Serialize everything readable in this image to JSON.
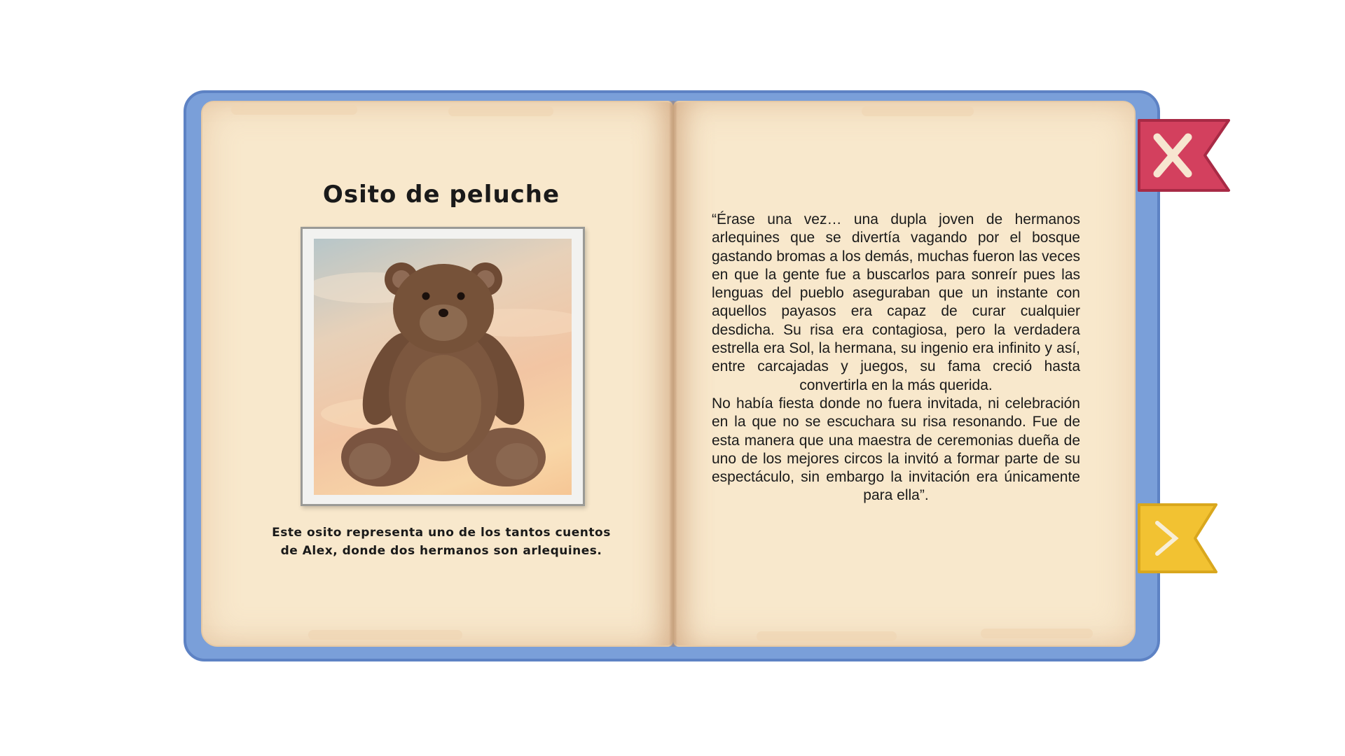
{
  "item": {
    "title": "Osito de peluche",
    "image_name": "teddy-bear",
    "caption": "Este osito representa uno de los tantos cuentos de Alex, donde dos hermanos son arlequines."
  },
  "story": {
    "paragraphs": [
      "“Érase una vez… una dupla joven de hermanos arlequines que se divertía vagando por el bosque gastando bromas a los demás, muchas fueron las veces en que la gente fue a buscarlos para sonreír pues las lenguas del pueblo aseguraban que un instante con aquellos payasos era capaz de curar cualquier desdicha. Su risa era contagiosa, pero la verdadera estrella era Sol, la hermana, su ingenio era infinito y así, entre carcajadas y juegos, su fama creció hasta convertirla en la más querida.",
      "No había fiesta donde no fuera invitada, ni celebración en la que no se escuchara su risa resonando. Fue de esta manera que una maestra de ceremonias dueña de uno de los mejores circos la invitó a formar parte de su espectáculo, sin embargo la invitación era únicamente para ella”."
    ]
  },
  "controls": {
    "close_icon": "close-icon",
    "next_icon": "chevron-right-icon"
  },
  "colors": {
    "cover": "#7a9fd9",
    "page": "#f8e8cc",
    "close_flag": "#d3405e",
    "next_flag": "#f2c232"
  }
}
